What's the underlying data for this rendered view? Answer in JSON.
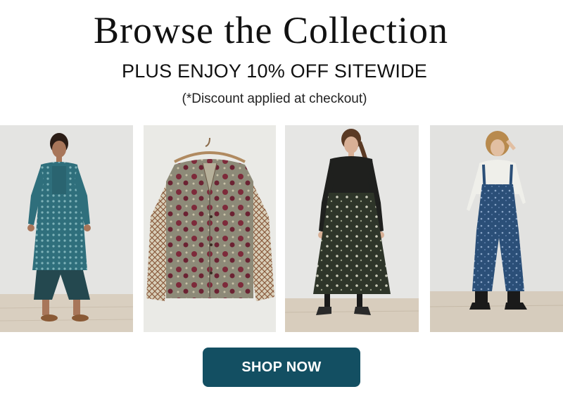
{
  "header": {
    "title": "Browse the Collection",
    "promo": "PLUS ENJOY 10% OFF SITEWIDE",
    "note": "(*Discount applied at checkout)"
  },
  "products": [
    {
      "name": "teal-print-tunic-with-cropped-pants",
      "icon": "product-photo"
    },
    {
      "name": "floral-print-shirt-on-hanger",
      "icon": "product-photo"
    },
    {
      "name": "dark-floral-midi-dress",
      "icon": "product-photo"
    },
    {
      "name": "blue-print-overalls",
      "icon": "product-photo"
    }
  ],
  "cta": {
    "label": "SHOP NOW"
  },
  "colors": {
    "button": "#134f62",
    "button_text": "#ffffff",
    "background": "#ffffff"
  }
}
